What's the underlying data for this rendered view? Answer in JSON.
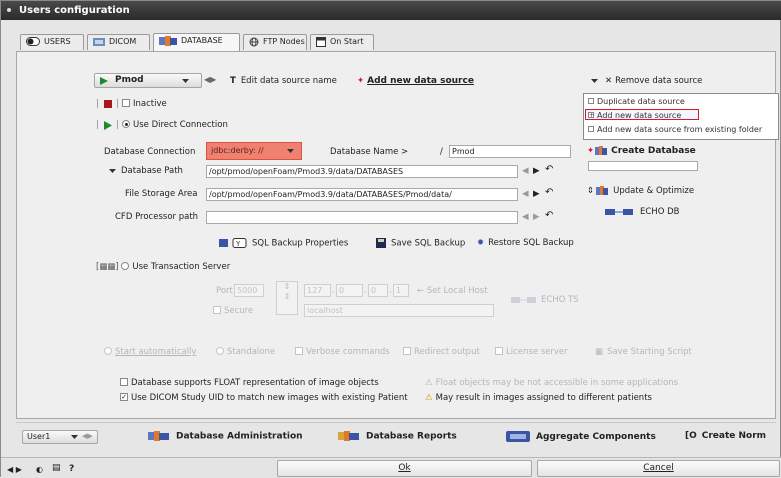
{
  "window": {
    "title": "Users configuration"
  },
  "tabs": [
    {
      "label": "USERS",
      "icon": "toggle-icon"
    },
    {
      "label": "DICOM",
      "icon": "dicom-icon"
    },
    {
      "label": "DATABASE",
      "icon": "database-icon",
      "active": true
    },
    {
      "label": "FTP Nodes",
      "icon": "globe-icon"
    },
    {
      "label": "On Start",
      "icon": "window-icon"
    }
  ],
  "toolbar": {
    "datasource_value": "Pmod",
    "edit_name": "Edit data source name",
    "add_new": "Add new data source",
    "remove": "Remove data source"
  },
  "dropdown_menu": {
    "items": [
      "Duplicate data source",
      "Add new data source",
      "Add new data source from existing folder"
    ],
    "highlighted_index": 1
  },
  "inactive_label": "Inactive",
  "direct_connection_label": "Use Direct Connection",
  "db_connection": {
    "label": "Database Connection",
    "value": "jdbc:derby: //",
    "db_name_label": "Database Name >",
    "db_name_prefix": "/",
    "db_name_value": "Pmod",
    "create_label": "Create Database"
  },
  "db_path": {
    "label": "Database Path",
    "value": "/opt/pmod/openFoam/Pmod3.9/data/DATABASES"
  },
  "file_storage": {
    "label": "File Storage Area",
    "value": "/opt/pmod/openFoam/Pmod3.9/data/DATABASES/Pmod/data/"
  },
  "cfd_path": {
    "label": "CFD Processor path",
    "value": ""
  },
  "update_label": "Update & Optimize",
  "echo_db_label": "ECHO DB",
  "sql": {
    "properties": "SQL Backup Properties",
    "save": "Save SQL Backup",
    "restore": "Restore SQL Backup"
  },
  "transaction": {
    "label": "Use Transaction Server",
    "port_label": "Port",
    "port_value": "5000",
    "ip_parts": [
      "127",
      "0",
      "0",
      "1"
    ],
    "set_local_host": "Set Local Host",
    "echo_ts": "ECHO TS",
    "secure_label": "Secure",
    "host_value": "localhost"
  },
  "start_row": {
    "start_auto": "Start automatically",
    "standalone": "Standalone",
    "verbose": "Verbose commands",
    "redirect": "Redirect output",
    "license": "License server",
    "save_script": "Save Starting Script"
  },
  "float_option": {
    "label": "Database supports FLOAT representation of image objects",
    "warning": "Float objects may be not accessible in some applications"
  },
  "dicom_uid_option": {
    "label": "Use DICOM Study UID to match new images with existing Patient",
    "warning": "May result in images assigned to different patients"
  },
  "bottom": {
    "user": "User1",
    "admin": "Database Administration",
    "reports": "Database Reports",
    "aggregate": "Aggregate Components",
    "create_norm": "Create Norm"
  },
  "footer": {
    "ok": "Ok",
    "cancel": "Cancel",
    "help": "?"
  },
  "colors": {
    "accent_red": "#d8182a",
    "highlight_orange": "#f08070",
    "play_green": "#1d8a2d"
  }
}
